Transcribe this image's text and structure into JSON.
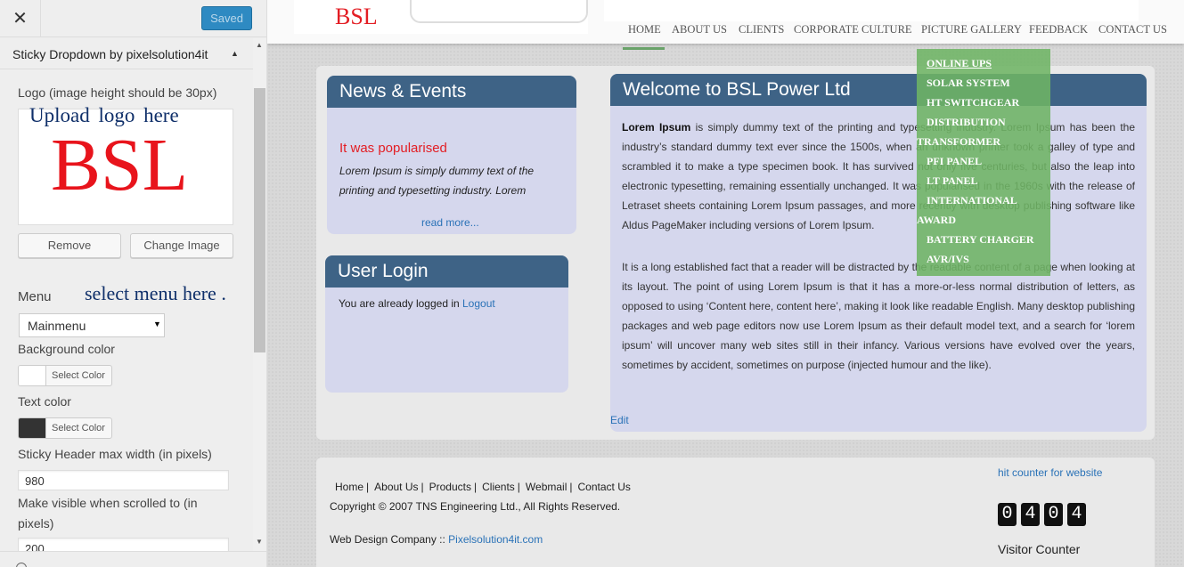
{
  "sidebar": {
    "close_icon": "close-icon",
    "saved_label": "Saved",
    "section_title": "Sticky Dropdown by pixelsolution4it",
    "logo_label": "Logo (image height should be 30px)",
    "logo_upload_note": "Upload logo here",
    "logo_text": "BSL",
    "remove_label": "Remove",
    "change_image_label": "Change Image",
    "menu_label": "Menu",
    "menu_note": "select menu here .",
    "menu_value": "Mainmenu",
    "bg_color_label": "Background color",
    "bg_color": "#ffffff",
    "select_color_label": "Select Color",
    "text_color_label": "Text color",
    "text_color": "#333333",
    "max_width_label": "Sticky Header max width (in pixels)",
    "max_width_value": "980",
    "visible_label": "Make visible when scrolled to (in pixels)",
    "visible_value": "200"
  },
  "site": {
    "logo_text": "BSL",
    "nav": [
      "HOME",
      "ABOUT US",
      "CLIENTS",
      "CORPORATE CULTURE",
      "PICTURE GALLERY",
      "FEEDBACK",
      "CONTACT US"
    ],
    "dropdown": [
      "ONLINE UPS",
      "SOLAR SYSTEM",
      "HT SWITCHGEAR",
      "DISTRIBUTION",
      "TRANSFORMER",
      "PFI PANEL",
      "LT PANEL",
      "INTERNATIONAL",
      "AWARD",
      "BATTERY CHARGER",
      "AVR/IVS"
    ],
    "news": {
      "title": "News & Events",
      "item_title": "It was popularised",
      "item_text": "Lorem Ipsum is simply dummy text of the printing and typesetting industry. Lorem",
      "more": "read more..."
    },
    "login": {
      "title": "User Login",
      "text": "You are already logged in ",
      "link": "Logout"
    },
    "welcome": {
      "title": "Welcome to BSL Power Ltd",
      "p1_bold": "Lorem Ipsum",
      "p1_rest": " is simply dummy text of the printing and typesetting industry. Lorem Ipsum has been the industry’s standard dummy text ever since the 1500s, when an unknown printer took a galley of type and scrambled it to make a type specimen book. It has survived not only five centuries, but also the leap into electronic typesetting, remaining essentially unchanged. It was popularised in the 1960s with the release of Letraset sheets containing Lorem Ipsum passages, and more recently with desktop publishing software like Aldus PageMaker including versions of Lorem Ipsum.",
      "p2": "It is a long established fact that a reader will be distracted by the readable content of a page when looking at its layout. The point of using Lorem Ipsum is that it has a more-or-less normal distribution of letters, as opposed to using ‘Content here, content here’, making it look like readable English. Many desktop publishing packages and web page editors now use Lorem Ipsum as their default model text, and a search for ‘lorem ipsum’ will uncover many web sites still in their infancy. Various versions have evolved over the years, sometimes by accident, sometimes on purpose (injected humour and the like).",
      "edit": "Edit"
    },
    "footer": {
      "links": [
        "Home",
        "About Us",
        "Products",
        "Clients",
        "Webmail",
        "Contact Us"
      ],
      "separator": "|",
      "copyright": "Copyright © 2007 TNS Engineering Ltd., All Rights Reserved.",
      "design_prefix": "Web Design Company :: ",
      "design_link": "Pixelsolution4it.com",
      "hit_counter_link": "hit counter for website",
      "counter_digits": [
        "0",
        "4",
        "0",
        "4"
      ],
      "visitor_counter_label": "Visitor Counter"
    }
  },
  "colors": {
    "accent": "#2e8ac2",
    "panel_header": "#3e6386",
    "panel_bg": "#d5d7ed",
    "dropdown_bg": "#6eb464",
    "brand_red": "#e31e24"
  }
}
